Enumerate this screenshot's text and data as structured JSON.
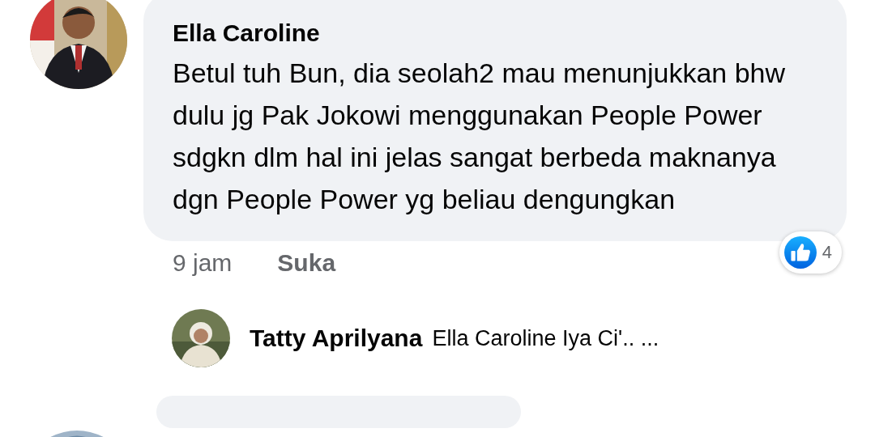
{
  "comment": {
    "author": "Ella Caroline",
    "text": "Betul tuh Bun, dia seolah2 mau menunjukkan bhw dulu jg Pak Jokowi menggunakan People Power sdgkn dlm hal ini jelas sangat berbeda maknanya dgn People Power yg beliau dengungkan",
    "time": "9 jam",
    "like_action": "Suka",
    "reactions": {
      "count": "4"
    }
  },
  "reply": {
    "author": "Tatty Aprilyana",
    "text": "Ella Caroline Iya Ci'.. ..."
  }
}
